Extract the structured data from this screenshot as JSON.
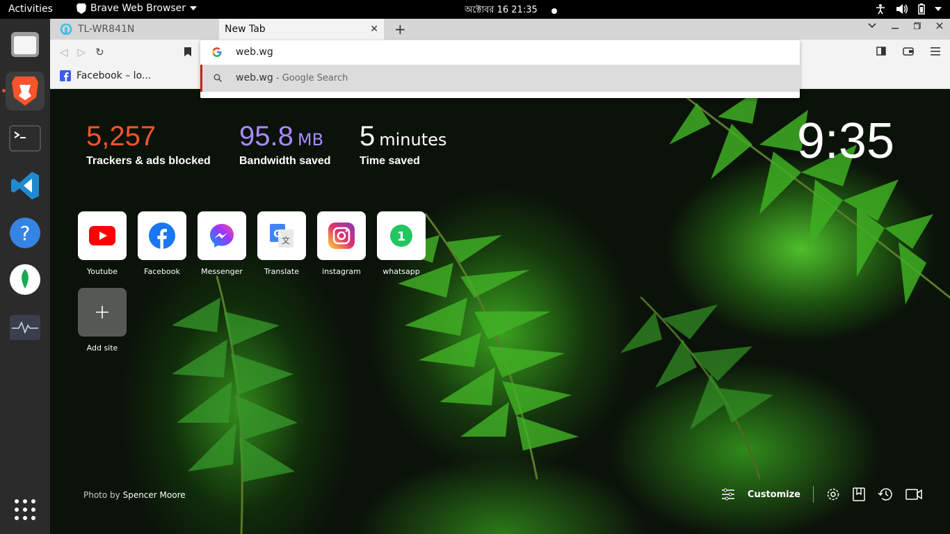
{
  "system": {
    "activities": "Activities",
    "app_name": "Brave Web Browser",
    "datetime": "অক্টোবর 16  21:35"
  },
  "tabs": [
    {
      "title": "TL-WR841N",
      "active": false
    },
    {
      "title": "New Tab",
      "active": true
    }
  ],
  "omnibox": {
    "input_value": "web.wg",
    "suggestion": "web.wg",
    "suggestion_suffix": " - Google Search"
  },
  "bookmarks": [
    {
      "label": "Facebook – lo..."
    }
  ],
  "stats": {
    "trackers": {
      "value": "5,257",
      "label": "Trackers & ads blocked",
      "color": "#fb542b"
    },
    "bandwidth": {
      "value": "95.8",
      "unit": "MB",
      "label": "Bandwidth saved",
      "color": "#a78bfa"
    },
    "time": {
      "value": "5",
      "unit": "minutes",
      "label": "Time saved",
      "color": "#ffffff"
    }
  },
  "clock": "9:35",
  "top_sites": [
    {
      "name": "Youtube",
      "icon": "youtube-icon"
    },
    {
      "name": "Facebook",
      "icon": "facebook-icon"
    },
    {
      "name": "Messenger",
      "icon": "messenger-icon"
    },
    {
      "name": "Translate",
      "icon": "translate-icon"
    },
    {
      "name": "instagram",
      "icon": "instagram-icon"
    },
    {
      "name": "whatsapp",
      "icon": "whatsapp-icon"
    }
  ],
  "add_site": "Add site",
  "photo_credit": {
    "prefix": "Photo by ",
    "author": "Spencer Moore"
  },
  "customize": "Customize",
  "colors": {
    "brave_orange": "#fb542b",
    "ubuntu_orange": "#e95420",
    "omnibox_highlight": "#c8201d"
  }
}
